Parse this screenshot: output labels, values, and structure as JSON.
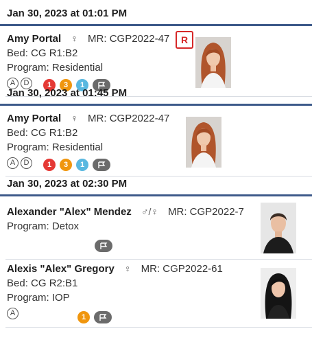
{
  "groups": [
    {
      "time": "Jan 30, 2023 at 01:01 PM",
      "patients": [
        {
          "name": "Amy Portal",
          "gender": "♀",
          "mr": "MR: CGP2022-47",
          "bed": "Bed: CG R1:B2",
          "program": "Program: Residential",
          "status_letters": [
            "A",
            "D"
          ],
          "badges": [
            {
              "value": "1",
              "color": "#e53935"
            },
            {
              "value": "3",
              "color": "#f0960e"
            },
            {
              "value": "1",
              "color": "#5ab8e0"
            }
          ],
          "flag": true,
          "r_flag": "R",
          "photo": "woman-red-hair"
        }
      ]
    },
    {
      "time": "Jan 30, 2023 at 01:45 PM",
      "patients": [
        {
          "name": "Amy Portal",
          "gender": "♀",
          "mr": "MR: CGP2022-47",
          "bed": "Bed: CG R1:B2",
          "program": "Program: Residential",
          "status_letters": [
            "A",
            "D"
          ],
          "badges": [
            {
              "value": "1",
              "color": "#e53935"
            },
            {
              "value": "3",
              "color": "#f0960e"
            },
            {
              "value": "1",
              "color": "#5ab8e0"
            }
          ],
          "flag": true,
          "photo": "woman-red-hair"
        }
      ]
    },
    {
      "time": "Jan 30, 2023 at 02:30 PM",
      "patients": [
        {
          "name": "Alexander \"Alex\" Mendez",
          "gender": "♂/♀",
          "mr": "MR: CGP2022-7",
          "program": "Program: Detox",
          "flag": true,
          "photo": "man-short-hair"
        },
        {
          "name": "Alexis \"Alex\" Gregory",
          "gender": "♀",
          "mr": "MR: CGP2022-61",
          "bed": "Bed: CG R2:B1",
          "program": "Program: IOP",
          "status_letters": [
            "A"
          ],
          "badges": [
            {
              "value": "1",
              "color": "#f0960e"
            }
          ],
          "flag": true,
          "photo": "woman-dark-hair"
        }
      ]
    }
  ]
}
